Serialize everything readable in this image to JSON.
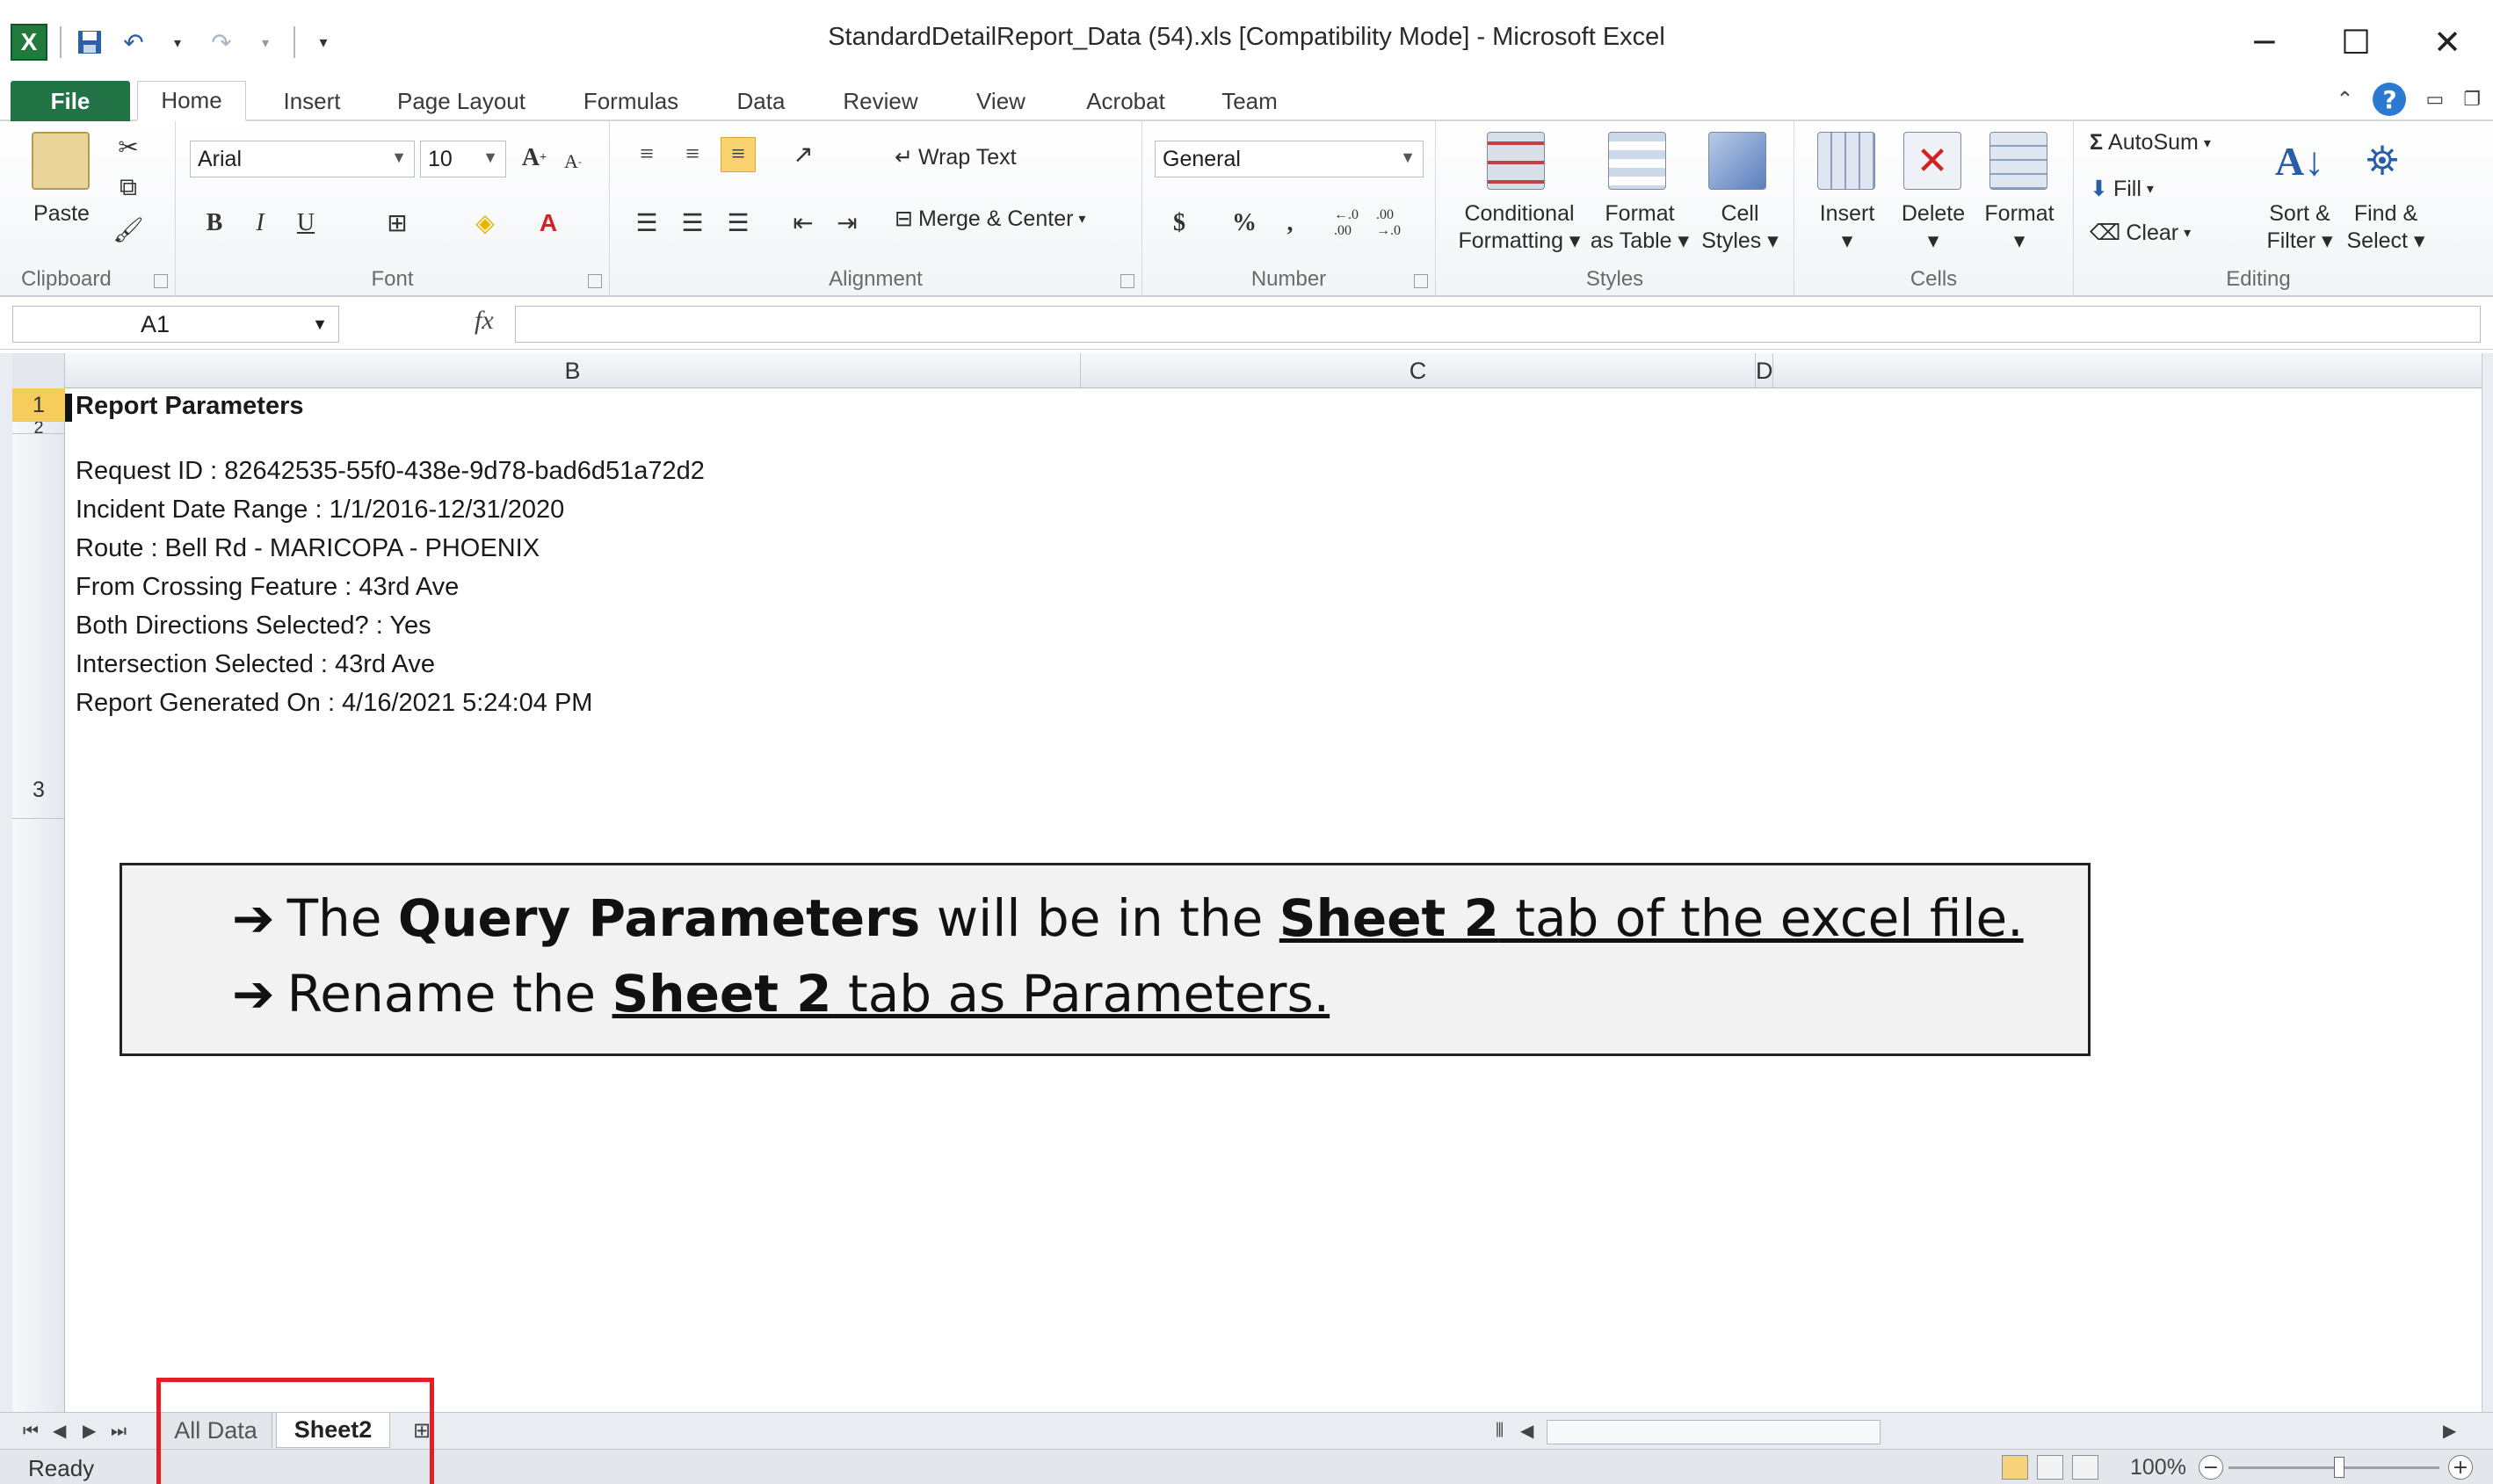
{
  "window": {
    "title": "StandardDetailReport_Data (54).xls  [Compatibility Mode]  -  Microsoft Excel",
    "minimize": "─",
    "maximize": "☐",
    "close": "✕"
  },
  "ribbon_tabs": [
    "File",
    "Home",
    "Insert",
    "Page Layout",
    "Formulas",
    "Data",
    "Review",
    "View",
    "Acrobat",
    "Team"
  ],
  "ribbon": {
    "clipboard": {
      "paste": "Paste",
      "label": "Clipboard"
    },
    "font": {
      "name": "Arial",
      "size": "10",
      "label": "Font",
      "bold": "B",
      "italic": "I",
      "underline": "U"
    },
    "alignment": {
      "wrap": "Wrap Text",
      "merge": "Merge & Center",
      "label": "Alignment"
    },
    "number": {
      "format": "General",
      "currency": "$",
      "percent": "%",
      "comma": ",",
      "inc_dec": "←.0 .00",
      "dec_dec": ".00 →.0",
      "label": "Number"
    },
    "styles": {
      "cond1": "Conditional",
      "cond2": "Formatting",
      "fmt1": "Format",
      "fmt2": "as Table",
      "cell1": "Cell",
      "cell2": "Styles",
      "label": "Styles"
    },
    "cells": {
      "insert": "Insert",
      "delete": "Delete",
      "format": "Format",
      "label": "Cells"
    },
    "editing": {
      "autosum": "AutoSum",
      "fill": "Fill",
      "clear": "Clear",
      "sort1": "Sort &",
      "sort2": "Filter",
      "find1": "Find &",
      "find2": "Select",
      "label": "Editing"
    }
  },
  "formula_bar": {
    "name_box": "A1",
    "fx": "fx",
    "value": ""
  },
  "columns": [
    "B",
    "C",
    "D"
  ],
  "rows": [
    "1",
    "2",
    "3"
  ],
  "cells": {
    "a1": "Report Parameters",
    "lines": [
      "Request ID : 82642535-55f0-438e-9d78-bad6d51a72d2",
      "Incident Date Range : 1/1/2016-12/31/2020",
      "Route : Bell Rd - MARICOPA - PHOENIX",
      "From Crossing Feature : 43rd Ave",
      "Both Directions Selected? : Yes",
      "Intersection Selected : 43rd Ave",
      "Report Generated On : 4/16/2021 5:24:04 PM"
    ]
  },
  "callout": {
    "line1": {
      "arrow": "➔",
      "a": "The ",
      "b": "Query Parameters",
      "c": " will be in the ",
      "d": "Sheet 2",
      "e": " tab of the excel file."
    },
    "line2": {
      "arrow": "➔",
      "a": "Rename the ",
      "d": "Sheet 2",
      "e": " tab as Parameters."
    }
  },
  "sheet_tabs": [
    "All Data",
    "Sheet2"
  ],
  "status": {
    "text": "Ready",
    "zoom": "100%"
  },
  "colors": {
    "excel_green": "#217346",
    "highlight": "#e41e26",
    "row_selected": "#f6cd5a"
  }
}
